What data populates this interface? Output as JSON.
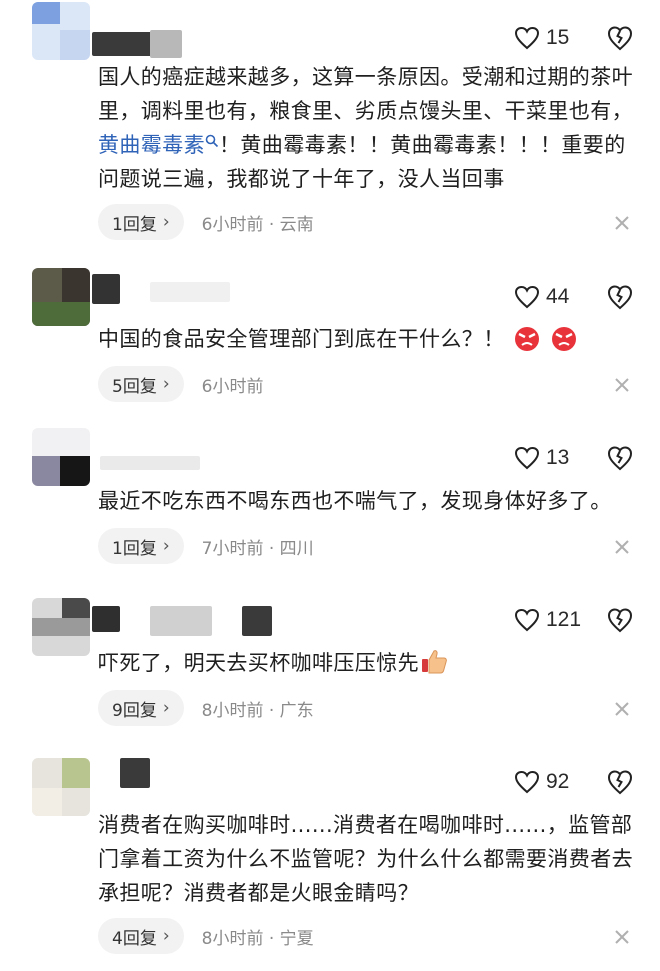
{
  "comments": [
    {
      "likes": "15",
      "text_parts": [
        "国人的癌症越来越多，这算一条原因。受潮和过期的茶叶里，调料里也有，粮食里、劣质点馒头里、干菜里也有，",
        "黄曲霉毒素",
        "！黄曲霉毒素！！黄曲霉毒素！！！重要的问题说三遍，我都说了十年了，没人当回事"
      ],
      "reply_label": "1回复",
      "meta": "6小时前 · 云南"
    },
    {
      "likes": "44",
      "text": "中国的食品安全管理部门到底在干什么？！",
      "emoji": "angry-face-icon",
      "reply_label": "5回复",
      "meta": "6小时前"
    },
    {
      "likes": "13",
      "text": "最近不吃东西不喝东西也不喘气了，发现身体好多了。",
      "reply_label": "1回复",
      "meta": "7小时前 · 四川"
    },
    {
      "likes": "121",
      "text": "吓死了，明天去买杯咖啡压压惊先",
      "emoji": "thumbs-up-icon",
      "reply_label": "9回复",
      "meta": "8小时前 · 广东"
    },
    {
      "likes": "92",
      "text": "消费者在购买咖啡时......消费者在喝咖啡时......，监管部门拿着工资为什么不监管呢？为什么什么都需要消费者去承担呢？消费者都是火眼金睛吗？",
      "reply_label": "4回复",
      "meta": "8小时前 · 宁夏"
    }
  ],
  "colors": {
    "link": "#2f63b8",
    "meta": "#8a8a8a",
    "reply_bg": "#f2f2f2"
  },
  "icons": {
    "like": "heart-icon",
    "dislike": "broken-heart-icon",
    "close": "close-icon",
    "search": "search-icon",
    "chevron": "chevron-right-icon"
  }
}
